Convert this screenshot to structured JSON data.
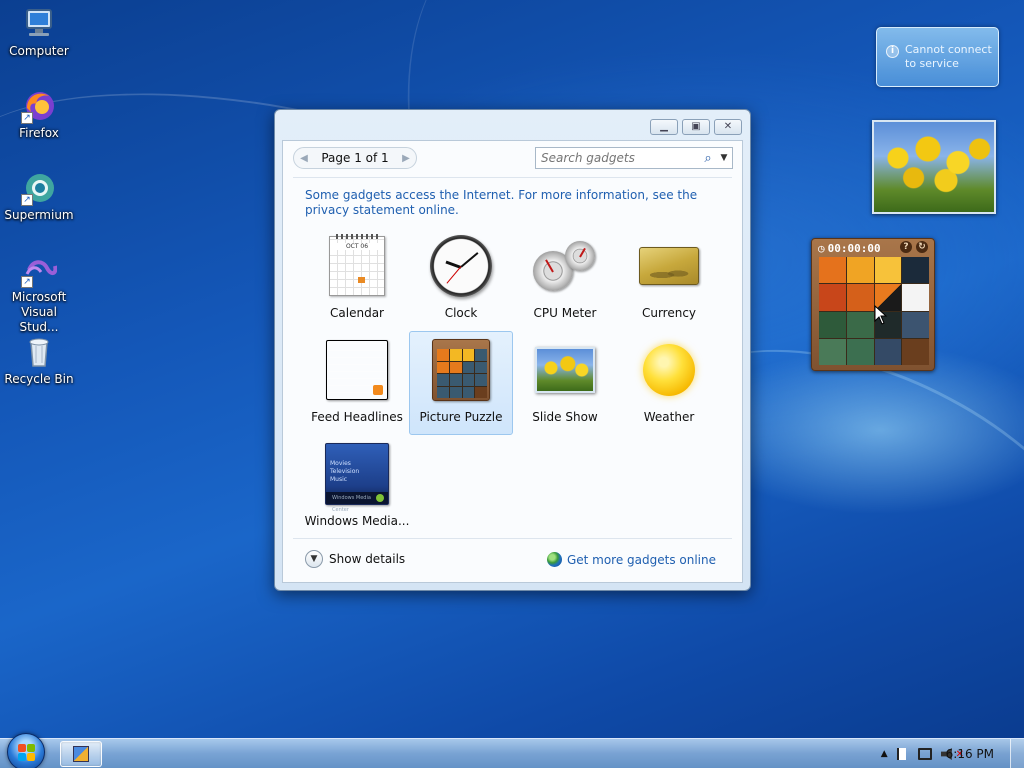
{
  "desktop": {
    "icons": [
      {
        "label": "Computer"
      },
      {
        "label": "Firefox"
      },
      {
        "label": "Supermium"
      },
      {
        "label": "Microsoft\nVisual Stud..."
      },
      {
        "label": "Recycle Bin"
      }
    ]
  },
  "sidebar": {
    "notification": "Cannot connect to service",
    "puzzle_time": "00:00:00"
  },
  "gadget_window": {
    "page_label": "Page 1 of 1",
    "search_placeholder": "Search gadgets",
    "notice": "Some gadgets access the Internet.  For more information, see the privacy statement online.",
    "gadgets": [
      {
        "name": "Calendar",
        "icon": "calendar-icon"
      },
      {
        "name": "Clock",
        "icon": "clock-icon"
      },
      {
        "name": "CPU Meter",
        "icon": "cpu-meter-icon"
      },
      {
        "name": "Currency",
        "icon": "currency-icon"
      },
      {
        "name": "Feed Headlines",
        "icon": "feed-headlines-icon"
      },
      {
        "name": "Picture Puzzle",
        "icon": "picture-puzzle-icon",
        "selected": true
      },
      {
        "name": "Slide Show",
        "icon": "slide-show-icon"
      },
      {
        "name": "Weather",
        "icon": "weather-icon"
      },
      {
        "name": "Windows Media...",
        "icon": "windows-media-icon"
      }
    ],
    "calendar_month": "OCT 06",
    "media_lines": [
      "Movies",
      "Television",
      "Music"
    ],
    "media_bar": "Windows Media Center",
    "show_details": "Show details",
    "get_more": "Get more gadgets online"
  },
  "taskbar": {
    "clock": "6:16 PM"
  },
  "colors": {
    "link": "#1f5fb0",
    "selection": "#cfe5fb"
  }
}
